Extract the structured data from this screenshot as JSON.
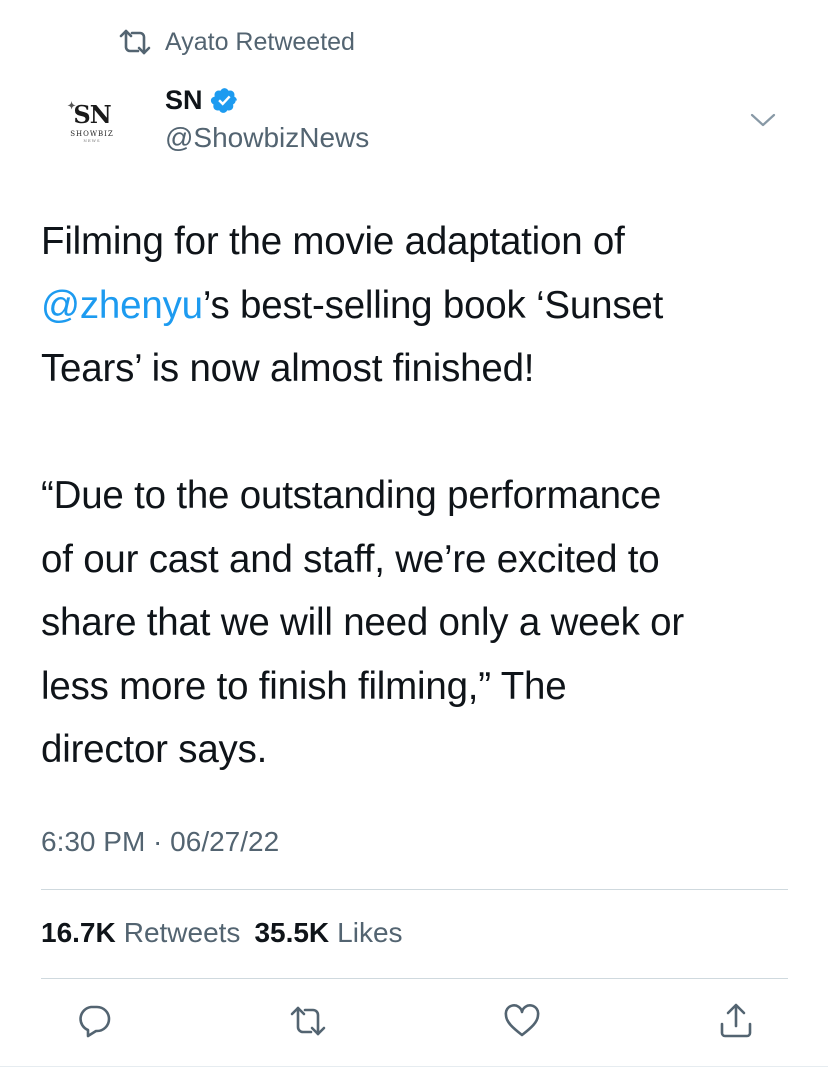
{
  "retweet_context": {
    "text": "Ayato Retweeted"
  },
  "author": {
    "avatar_text": "SN",
    "avatar_subtext": "SHOWBIZ",
    "avatar_subtext2": "NEWS",
    "display_name": "SN",
    "handle": "@ShowbizNews",
    "verified": true
  },
  "tweet": {
    "line1_text": "Filming for the movie adaptation of",
    "mention": "@zhenyu",
    "line2_rest": "’s best-selling book ‘Sunset",
    "line3_text": "Tears’ is now almost finished!",
    "paragraph2_lines": [
      "“Due to the outstanding performance",
      "of our cast and staff, we’re excited to",
      "share that we will need only a week or",
      "less more to finish filming,” The",
      "director says."
    ]
  },
  "timestamp": {
    "time": "6:30 PM",
    "separator": " · ",
    "date": "06/27/22"
  },
  "stats": {
    "retweets_count": "16.7K",
    "retweets_label": "Retweets",
    "likes_count": "35.5K",
    "likes_label": "Likes"
  },
  "icons": {
    "retweet_context": "retweet-icon",
    "verified": "verified-badge-icon",
    "more": "chevron-down-icon",
    "reply": "reply-icon",
    "retweet": "retweet-icon",
    "like": "heart-icon",
    "share": "share-icon"
  },
  "colors": {
    "accent": "#1d9bf0",
    "text_primary": "#0f1419",
    "text_secondary": "#536471",
    "divider": "#cfd9de"
  }
}
